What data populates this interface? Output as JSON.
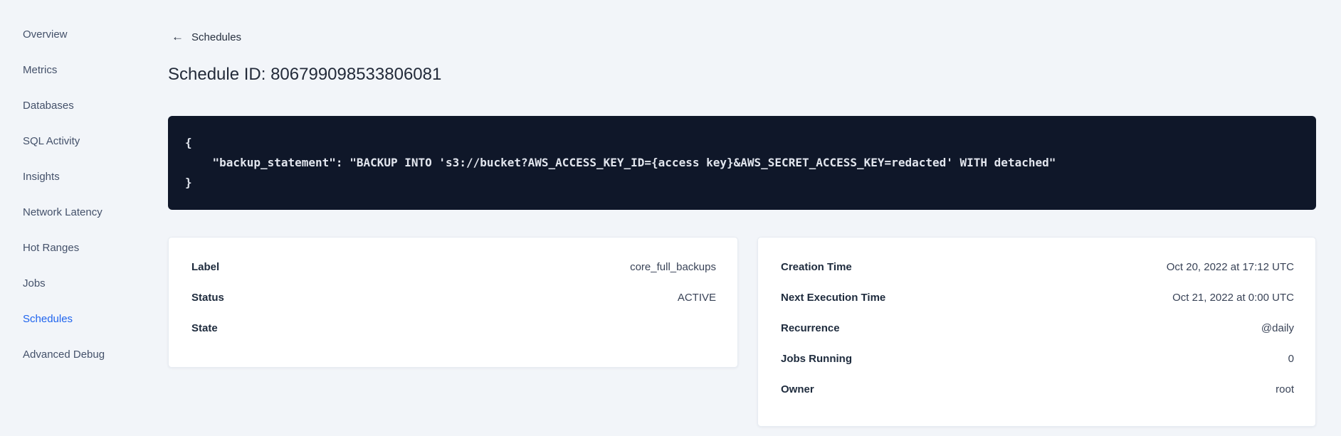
{
  "sidebar": {
    "items": [
      {
        "label": "Overview",
        "active": false
      },
      {
        "label": "Metrics",
        "active": false
      },
      {
        "label": "Databases",
        "active": false
      },
      {
        "label": "SQL Activity",
        "active": false
      },
      {
        "label": "Insights",
        "active": false
      },
      {
        "label": "Network Latency",
        "active": false
      },
      {
        "label": "Hot Ranges",
        "active": false
      },
      {
        "label": "Jobs",
        "active": false
      },
      {
        "label": "Schedules",
        "active": true
      },
      {
        "label": "Advanced Debug",
        "active": false
      }
    ]
  },
  "header": {
    "back_icon": "←",
    "back_label": "Schedules",
    "title": "Schedule ID: 806799098533806081"
  },
  "code_block": {
    "lines": [
      "{",
      "    \"backup_statement\": \"BACKUP INTO 's3://bucket?AWS_ACCESS_KEY_ID={access key}&AWS_SECRET_ACCESS_KEY=redacted' WITH detached\"",
      "}"
    ]
  },
  "schedule_details": {
    "rows": [
      {
        "label": "Label",
        "value": "core_full_backups"
      },
      {
        "label": "Status",
        "value": "ACTIVE"
      },
      {
        "label": "State",
        "value": ""
      }
    ]
  },
  "execution_details": {
    "rows": [
      {
        "label": "Creation Time",
        "value": "Oct 20, 2022 at 17:12 UTC"
      },
      {
        "label": "Next Execution Time",
        "value": "Oct 21, 2022 at 0:00 UTC"
      },
      {
        "label": "Recurrence",
        "value": "@daily"
      },
      {
        "label": "Jobs Running",
        "value": "0"
      },
      {
        "label": "Owner",
        "value": "root"
      }
    ]
  },
  "colors": {
    "page_background": "#f2f5f9",
    "card_background": "#ffffff",
    "code_background": "#0f1729",
    "code_text": "#e2e6ee",
    "accent_active": "#1f64ee",
    "text_primary": "#232b3a",
    "text_nav": "#44516a"
  }
}
